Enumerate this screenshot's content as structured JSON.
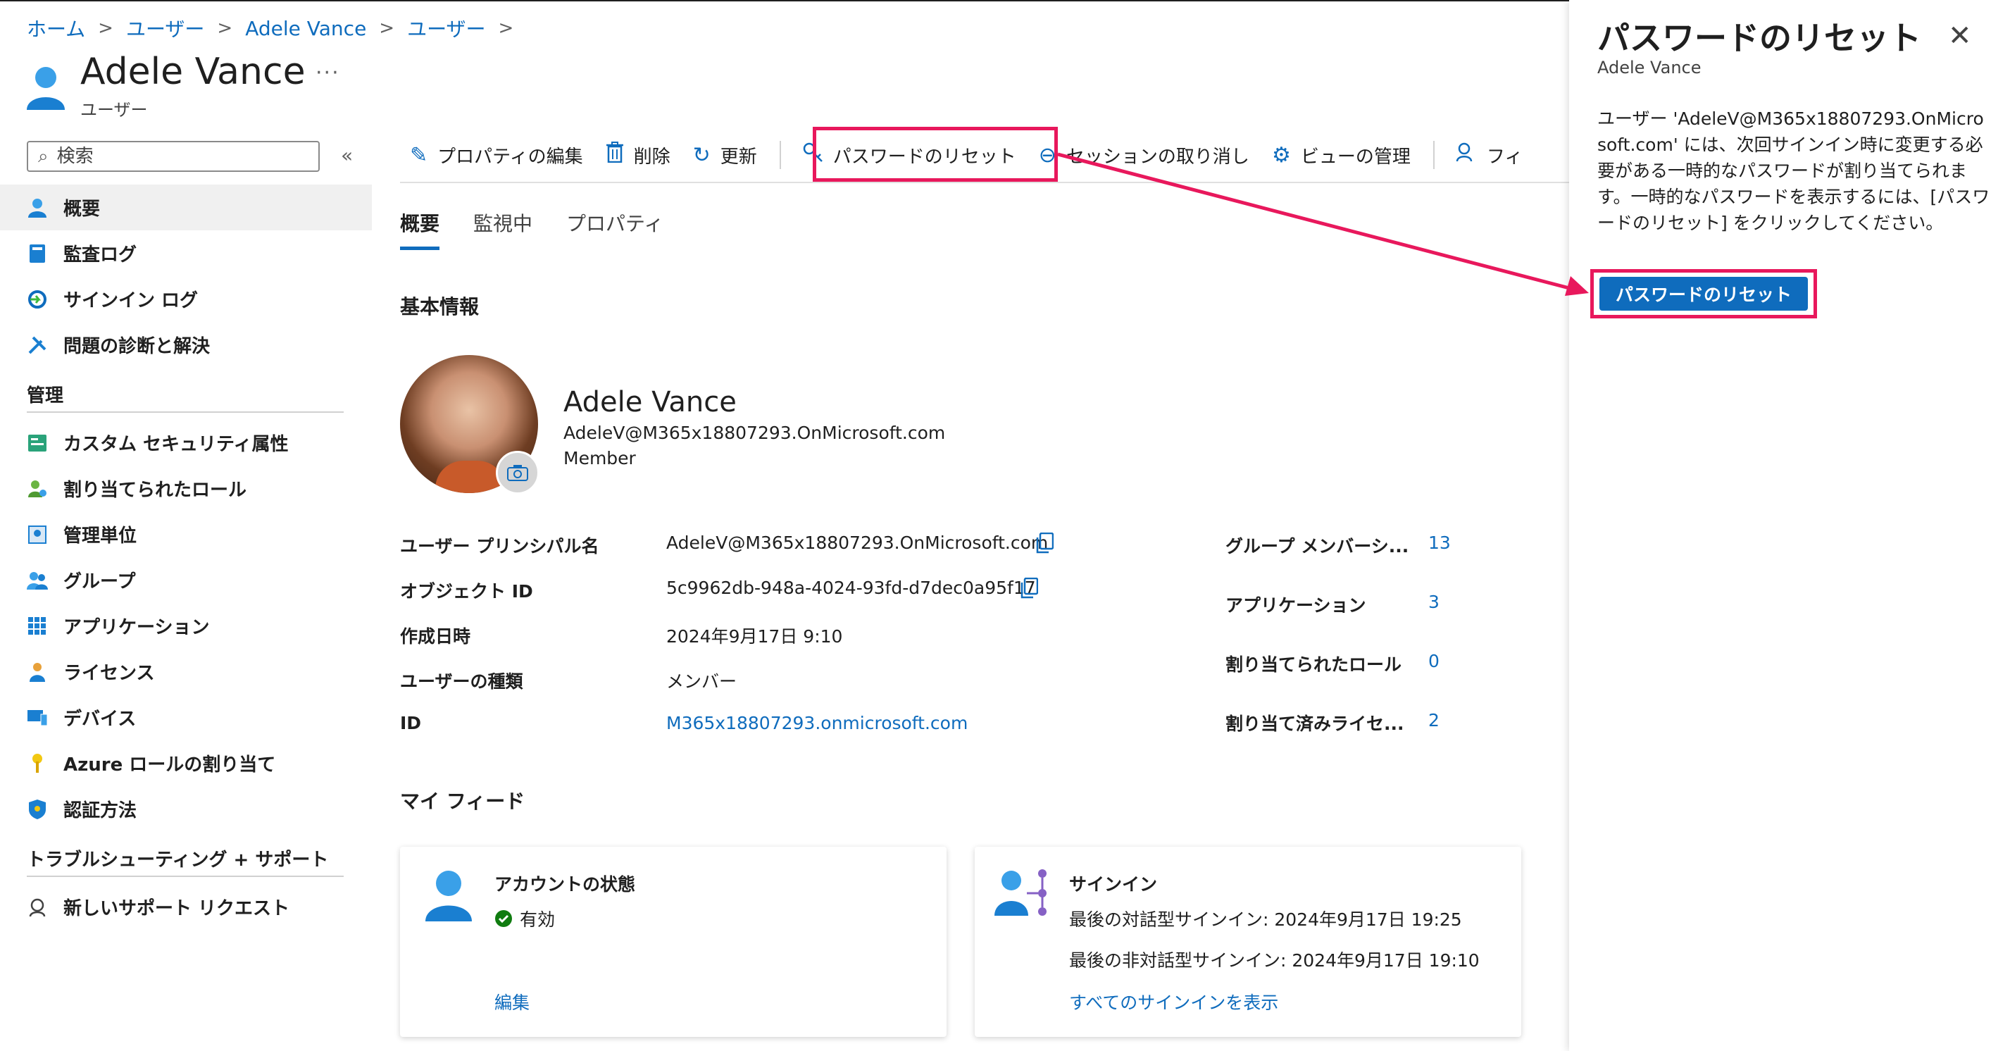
{
  "breadcrumb": [
    "ホーム",
    "ユーザー",
    "Adele Vance",
    "ユーザー"
  ],
  "header": {
    "title": "Adele Vance",
    "subtitle": "ユーザー",
    "more": "···"
  },
  "search": {
    "placeholder": "検索",
    "collapse": "«"
  },
  "nav": {
    "items_top": [
      {
        "label": "概要",
        "icon": "user-icon"
      },
      {
        "label": "監査ログ",
        "icon": "book-icon"
      },
      {
        "label": "サインイン ログ",
        "icon": "signin-icon"
      },
      {
        "label": "問題の診断と解決",
        "icon": "wrench-icon"
      }
    ],
    "section_manage": "管理",
    "items_manage": [
      {
        "label": "カスタム セキュリティ属性",
        "icon": "attribute-icon"
      },
      {
        "label": "割り当てられたロール",
        "icon": "role-icon"
      },
      {
        "label": "管理単位",
        "icon": "admin-unit-icon"
      },
      {
        "label": "グループ",
        "icon": "group-icon"
      },
      {
        "label": "アプリケーション",
        "icon": "apps-icon"
      },
      {
        "label": "ライセンス",
        "icon": "license-icon"
      },
      {
        "label": "デバイス",
        "icon": "device-icon"
      },
      {
        "label": "Azure ロールの割り当て",
        "icon": "key-icon"
      },
      {
        "label": "認証方法",
        "icon": "shield-icon"
      }
    ],
    "section_support": "トラブルシューティング + サポート",
    "items_support": [
      {
        "label": "新しいサポート リクエスト",
        "icon": "support-icon"
      }
    ]
  },
  "toolbar": {
    "edit": "プロパティの編集",
    "delete": "削除",
    "refresh": "更新",
    "reset_password": "パスワードのリセット",
    "revoke": "セッションの取り消し",
    "manage_view": "ビューの管理",
    "feedback": "フィ"
  },
  "tabs": [
    "概要",
    "監視中",
    "プロパティ"
  ],
  "basic_info": {
    "heading": "基本情報",
    "name": "Adele Vance",
    "email": "AdeleV@M365x18807293.OnMicrosoft.com",
    "role": "Member"
  },
  "properties": [
    {
      "label": "ユーザー プリンシパル名",
      "value": "AdeleV@M365x18807293.OnMicrosoft.com"
    },
    {
      "label": "オブジェクト ID",
      "value": "5c9962db-948a-4024-93fd-d7dec0a95f17"
    },
    {
      "label": "作成日時",
      "value": "2024年9月17日 9:10"
    },
    {
      "label": "ユーザーの種類",
      "value": "メンバー"
    },
    {
      "label": "ID",
      "value": "M365x18807293.onmicrosoft.com"
    }
  ],
  "stats": [
    {
      "label": "グループ メンバーシ...",
      "value": "13"
    },
    {
      "label": "アプリケーション",
      "value": "3"
    },
    {
      "label": "割り当てられたロール",
      "value": "0"
    },
    {
      "label": "割り当て済みライセ...",
      "value": "2"
    }
  ],
  "feed": {
    "heading": "マイ フィード",
    "account": {
      "title": "アカウントの状態",
      "status": "有効",
      "link": "編集"
    },
    "signin": {
      "title": "サインイン",
      "interactive": "最後の対話型サインイン: 2024年9月17日 19:25",
      "noninteractive": "最後の非対話型サインイン: 2024年9月17日 19:10",
      "link": "すべてのサインインを表示"
    }
  },
  "panel": {
    "title": "パスワードのリセット",
    "subtitle": "Adele Vance",
    "description": "ユーザー 'AdeleV@M365x18807293.OnMicrosoft.com' には、次回サインイン時に変更する必要がある一時的なパスワードが割り当てられます。一時的なパスワードを表示するには、[パスワードのリセット] をクリックしてください。",
    "button": "パスワードのリセット",
    "close": "✕"
  },
  "colors": {
    "accent": "#0f6cbd",
    "highlight": "#e8185c",
    "success": "#107c10"
  }
}
